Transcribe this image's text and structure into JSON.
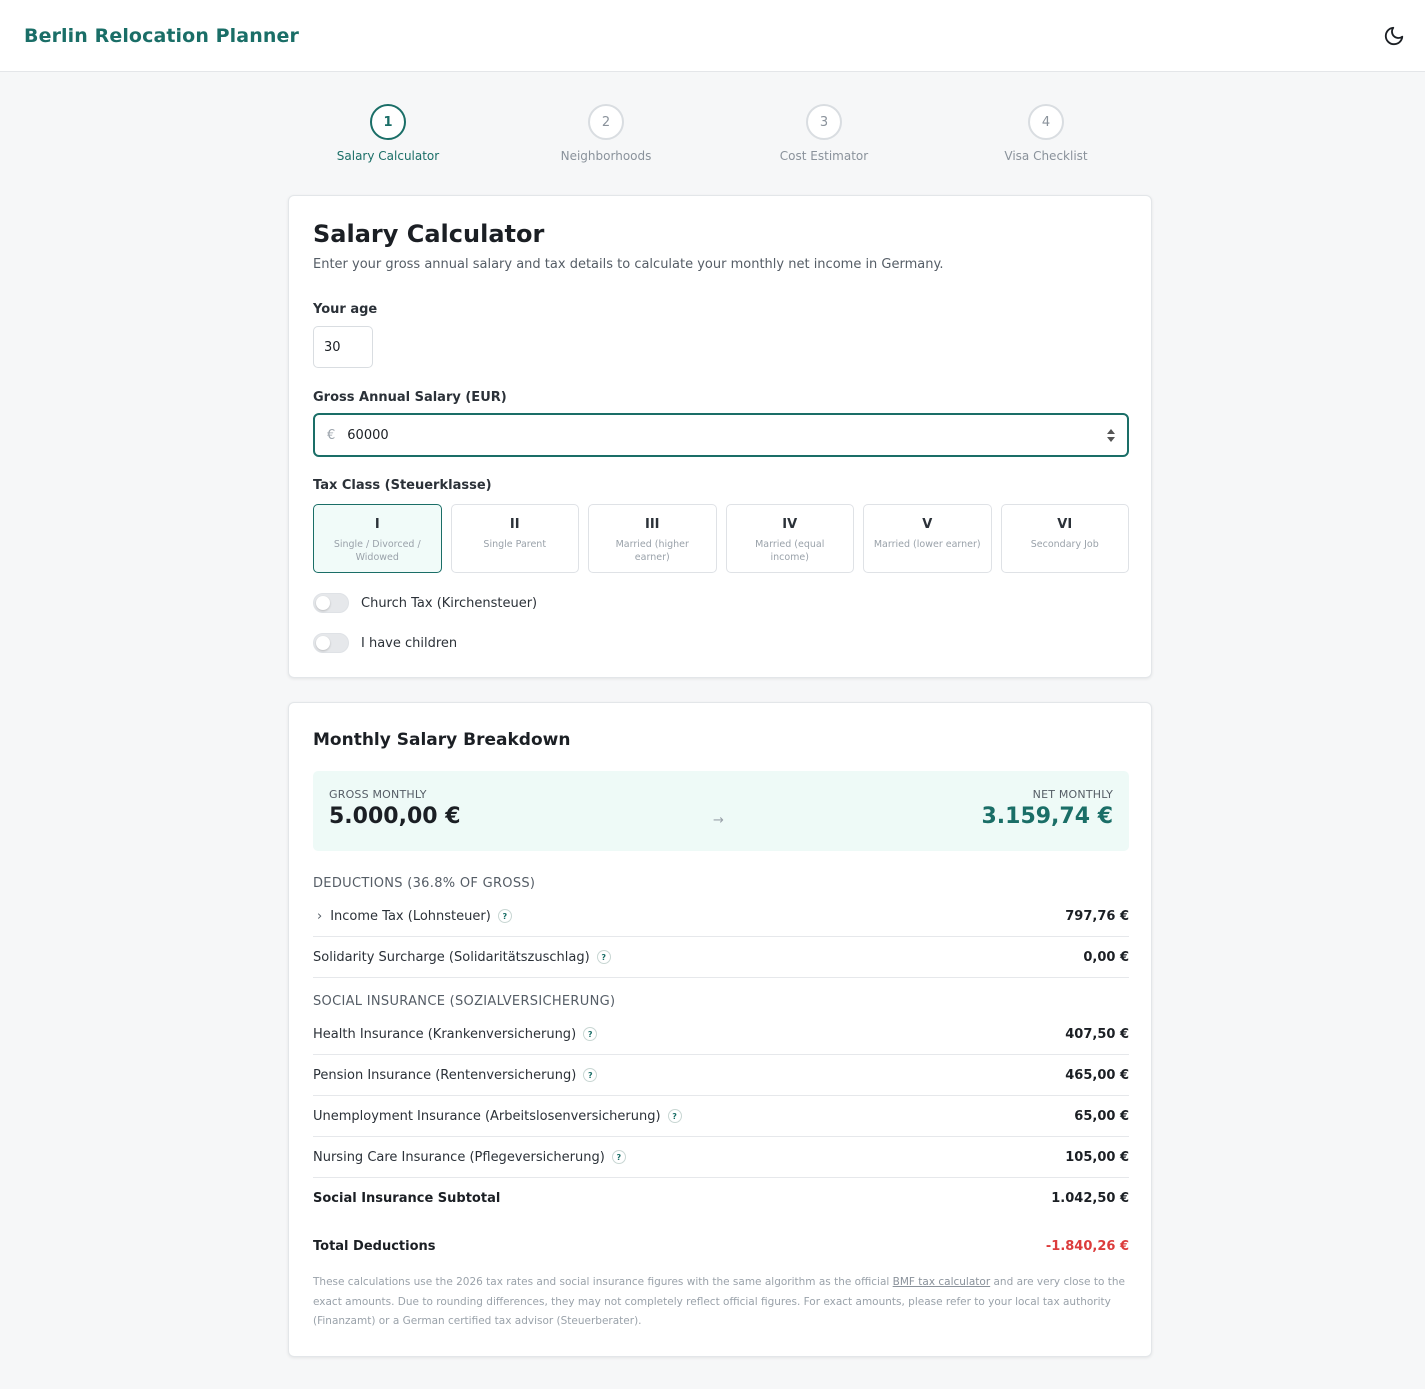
{
  "app": {
    "title": "Berlin Relocation Planner",
    "theme_icon": "moon-icon"
  },
  "steps": [
    {
      "num": "1",
      "label": "Salary Calculator",
      "active": true
    },
    {
      "num": "2",
      "label": "Neighborhoods",
      "active": false
    },
    {
      "num": "3",
      "label": "Cost Estimator",
      "active": false
    },
    {
      "num": "4",
      "label": "Visa Checklist",
      "active": false
    }
  ],
  "calculator": {
    "title": "Salary Calculator",
    "subtitle": "Enter your gross annual salary and tax details to calculate your monthly net income in Germany.",
    "age_label": "Your age",
    "age_value": "30",
    "salary_label": "Gross Annual Salary (EUR)",
    "salary_prefix": "€",
    "salary_value": "60000",
    "taxclass_label": "Tax Class (Steuerklasse)",
    "tax_classes": [
      {
        "num": "I",
        "desc": "Single / Divorced / Widowed",
        "selected": true
      },
      {
        "num": "II",
        "desc": "Single Parent",
        "selected": false
      },
      {
        "num": "III",
        "desc": "Married (higher earner)",
        "selected": false
      },
      {
        "num": "IV",
        "desc": "Married (equal income)",
        "selected": false
      },
      {
        "num": "V",
        "desc": "Married (lower earner)",
        "selected": false
      },
      {
        "num": "VI",
        "desc": "Secondary Job",
        "selected": false
      }
    ],
    "church_tax_label": "Church Tax (Kirchensteuer)",
    "children_label": "I have children"
  },
  "breakdown": {
    "title": "Monthly Salary Breakdown",
    "gross_caption": "GROSS MONTHLY",
    "gross_value": "5.000,00 €",
    "arrow": "→",
    "net_caption": "NET MONTHLY",
    "net_value": "3.159,74 €",
    "deductions_caption": "DEDUCTIONS (36.8% OF GROSS)",
    "income_tax": {
      "label": "Income Tax (Lohnsteuer)",
      "value": "797,76 €"
    },
    "solidarity": {
      "label": "Solidarity Surcharge (Solidaritätszuschlag)",
      "value": "0,00 €"
    },
    "social_caption": "SOCIAL INSURANCE (SOZIALVERSICHERUNG)",
    "health": {
      "label": "Health Insurance (Krankenversicherung)",
      "value": "407,50 €"
    },
    "pension": {
      "label": "Pension Insurance (Rentenversicherung)",
      "value": "465,00 €"
    },
    "unemployment": {
      "label": "Unemployment Insurance (Arbeitslosenversicherung)",
      "value": "65,00 €"
    },
    "nursing": {
      "label": "Nursing Care Insurance (Pflegeversicherung)",
      "value": "105,00 €"
    },
    "subtotal": {
      "label": "Social Insurance Subtotal",
      "value": "1.042,50 €"
    },
    "total": {
      "label": "Total Deductions",
      "value": "-1.840,26 €"
    },
    "help_glyph": "?",
    "expand_glyph": "›",
    "disclaimer_pre": "These calculations use the 2026 tax rates and social insurance figures with the same algorithm as the official ",
    "disclaimer_link": "BMF tax calculator",
    "disclaimer_post": " and are very close to the exact amounts. Due to rounding differences, they may not completely reflect official figures. For exact amounts, please refer to your local tax authority (Finanzamt) or a German certified tax advisor (Steuerberater).",
    "negative_color": "#dc3c3c"
  },
  "colors": {
    "accent": "#1a6e67",
    "summary_bg": "#eefaf7",
    "page_bg": "#f6f7f8"
  }
}
